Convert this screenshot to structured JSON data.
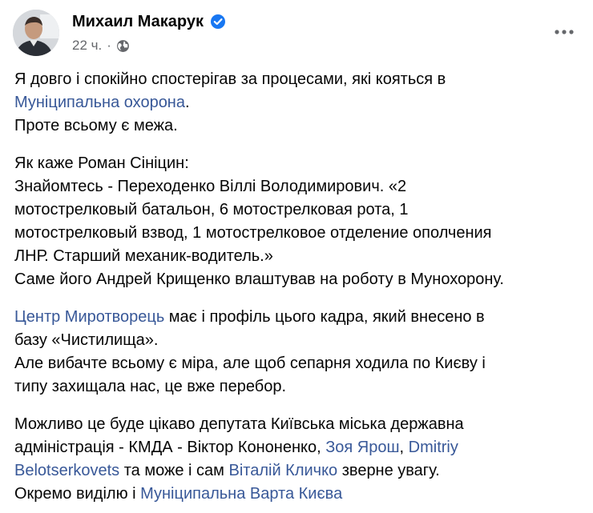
{
  "author": {
    "name": "Михаил Макарук",
    "time": "22 ч.",
    "separator": "·"
  },
  "post": {
    "p1": {
      "t1": "Я довго і спокійно спостерігав за процесами, які кояться в",
      "link1": "Муніципальна охорона",
      "t2": ".",
      "t3": "Проте всьому є межа."
    },
    "p2": {
      "l1": "Як каже Роман Сініцин:",
      "l2": "Знайомтесь - Переходенко Віллі Володимирович. «2",
      "l3": "мотострелковый батальон, 6 мотострелковая рота, 1",
      "l4": "мотострелковый взвод, 1 мотострелковое отделение ополчения",
      "l5": "ЛНР. Старший механик-водитель.»",
      "l6": "Саме його Андрей Крищенко влаштував на роботу в Мунохорону."
    },
    "p3": {
      "link1": "Центр Миротворець",
      "t1": " має і профіль цього кадра, який внесено в",
      "t2": "базу «Чистилища».",
      "t3": "Але вибачте всьому є міра, але щоб сепарня ходила по Києву і",
      "t4": "типу захищала нас, це вже перебор."
    },
    "p4": {
      "t1": "Можливо це буде цікаво депутата Київська міська державна",
      "t2": "адміністрація - КМДА - Віктор Кононенко, ",
      "link1": "Зоя Ярош",
      "t3": ", ",
      "link2a": "Dmitriy",
      "link2b": "Belotserkovets",
      "t4": " та може і сам ",
      "link3": "Віталій Кличко",
      "t5": " зверне увагу.",
      "t6": "Окремо виділю і ",
      "link4": "Муніципальна Варта Києва"
    }
  },
  "colors": {
    "link": "#385898",
    "verified": "#1877f2",
    "muted": "#65676b",
    "text": "#050505"
  },
  "icons": {
    "verified": "verified-badge-icon",
    "globe": "globe-icon",
    "more": "more-dots-icon"
  }
}
